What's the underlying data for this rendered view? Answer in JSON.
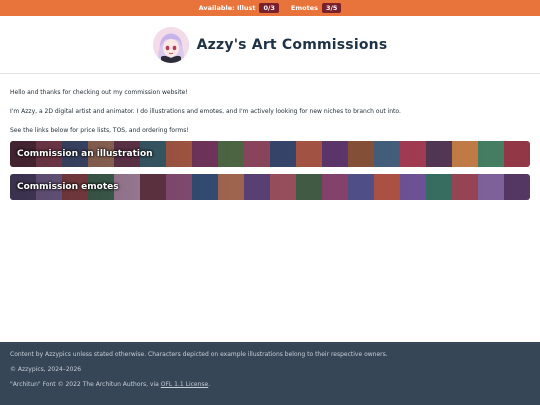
{
  "topbar": {
    "illust_label": "Available: Illust",
    "illust_count": "0/3",
    "emotes_label": "Emotes",
    "emotes_count": "3/5",
    "bar_color": "#e8743b",
    "badge_color": "#7a1f2c"
  },
  "header": {
    "avatar_icon": "avatar-girl-icon",
    "title": "Azzy's Art Commissions"
  },
  "intro": {
    "line1": "Hello and thanks for checking out my commission website!",
    "line2": "I'm Azzy, a 2D digital artist and animator. I do illustrations and emotes, and I'm actively looking for new niches to branch out into.",
    "line3": "See the links below for price lists, TOS, and ordering forms!"
  },
  "links": [
    {
      "label": "Commission an illustration"
    },
    {
      "label": "Commission emotes"
    }
  ],
  "footer": {
    "line1": "Content by Azzypics unless stated otherwise. Characters depicted on example illustrations belong to their respective owners.",
    "line2": "© Azzypics, 2024–2026",
    "line3_prefix": "\"Architun\" Font © 2022 The Architun Authors, via ",
    "line3_link": "OFL 1.1 License",
    "line3_suffix": ".",
    "bg_color": "#374656"
  }
}
